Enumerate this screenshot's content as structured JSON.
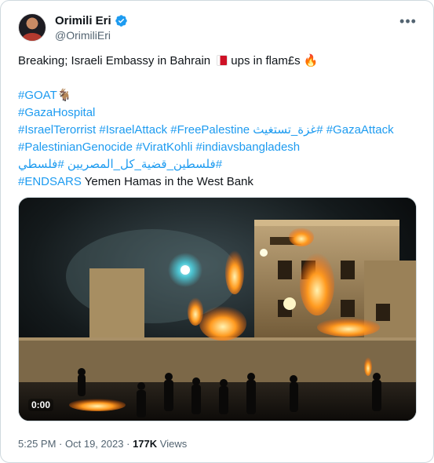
{
  "author": {
    "name": "Orimili Eri",
    "handle": "@OrimiliEri",
    "verified": true
  },
  "more_icon": "more-horizontal-icon",
  "tweet": {
    "line1_before_flag": "Breaking; Israeli Embassy in Bahrain",
    "line1_after_flag": "ups in flam£s",
    "fire_emoji": "🔥",
    "hashtags_line1": "#GOAT",
    "hashtags_line2": "#GazaHospital",
    "hashtags_line3_a": "#IsraelTerorrist #IsraelAttack #FreePalestine",
    "hashtags_line3_rtl": "#غزة_تستغيث",
    "hashtags_line3_b": "#GazaAttack",
    "hashtags_line4": "#PalestinianGenocide #ViratKohli #indiavsbangladesh",
    "hashtags_line5_rtl": "#فلسطين_قضية_كل_المصريين #فلسطي",
    "hashtags_line6": "#ENDSARS",
    "line6_text": "Yemen Hamas in the West Bank"
  },
  "media": {
    "duration": "0:00"
  },
  "meta": {
    "time": "5:25 PM",
    "separator": "·",
    "date": "Oct 19, 2023",
    "separator2": "·",
    "views_count": "177K",
    "views_label": "Views"
  },
  "colors": {
    "link": "#1d9bf0",
    "secondary_text": "#536471",
    "verified_badge": "#1d9bf0"
  }
}
